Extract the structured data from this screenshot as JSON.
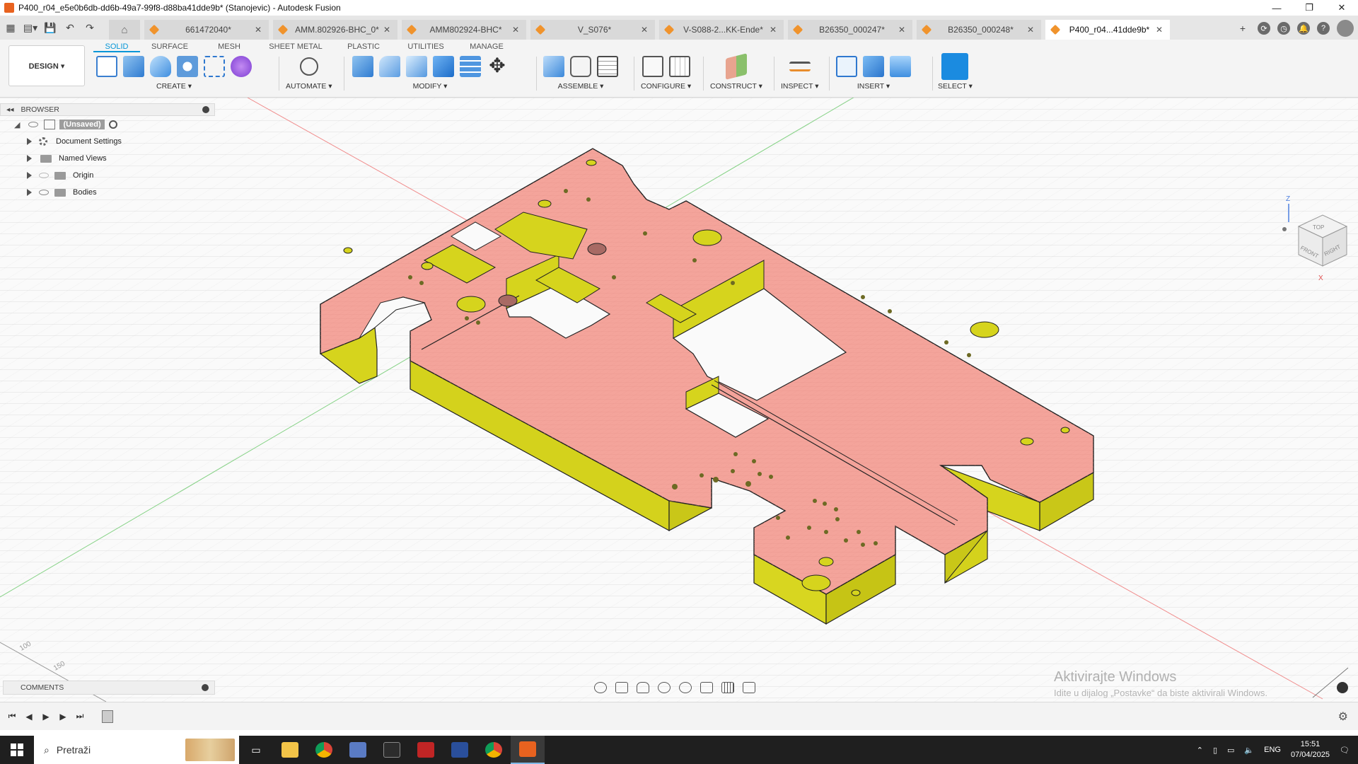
{
  "window": {
    "title": "P400_r04_e5e0b6db-dd6b-49a7-99f8-d88ba41dde9b* (Stanojevic) - Autodesk Fusion",
    "controls": [
      "—",
      "❐",
      "✕"
    ]
  },
  "tabs": [
    {
      "label": "661472040*"
    },
    {
      "label": "AMM.802926-BHC_0*"
    },
    {
      "label": "AMM802924-BHC*"
    },
    {
      "label": "V_S076*"
    },
    {
      "label": "V-S088-2...KK-Ende*"
    },
    {
      "label": "B26350_000247*"
    },
    {
      "label": "B26350_000248*"
    },
    {
      "label": "P400_r04...41dde9b*"
    }
  ],
  "toolbar": {
    "workspace": "DESIGN ▾",
    "ribbon_tabs": [
      "SOLID",
      "SURFACE",
      "MESH",
      "SHEET METAL",
      "PLASTIC",
      "UTILITIES",
      "MANAGE"
    ],
    "groups": {
      "create": "CREATE ▾",
      "automate": "AUTOMATE ▾",
      "modify": "MODIFY ▾",
      "assemble": "ASSEMBLE ▾",
      "configure": "CONFIGURE ▾",
      "construct": "CONSTRUCT ▾",
      "inspect": "INSPECT ▾",
      "insert": "INSERT ▾",
      "select": "SELECT ▾"
    }
  },
  "browser": {
    "header": "BROWSER",
    "root": "(Unsaved)",
    "items": [
      {
        "label": "Document Settings"
      },
      {
        "label": "Named Views"
      },
      {
        "label": "Origin"
      },
      {
        "label": "Bodies"
      }
    ]
  },
  "viewcube": {
    "top": "TOP",
    "front": "FRONT",
    "right": "RIGHT",
    "z": "Z",
    "x": "X"
  },
  "canvas": {
    "axis_label_1": "100",
    "axis_label_2": "150"
  },
  "comments": {
    "header": "COMMENTS"
  },
  "watermark": {
    "line1": "Aktivirajte Windows",
    "line2": "Idite u dijalog „Postavke“ da biste aktivirali Windows."
  },
  "taskbar": {
    "search_placeholder": "Pretraži",
    "lang": "ENG",
    "time": "15:51",
    "date": "07/04/2025"
  },
  "colors": {
    "accent": "#0696d7",
    "plate_top": "#f3a39b",
    "plate_side": "#d8d51f"
  }
}
